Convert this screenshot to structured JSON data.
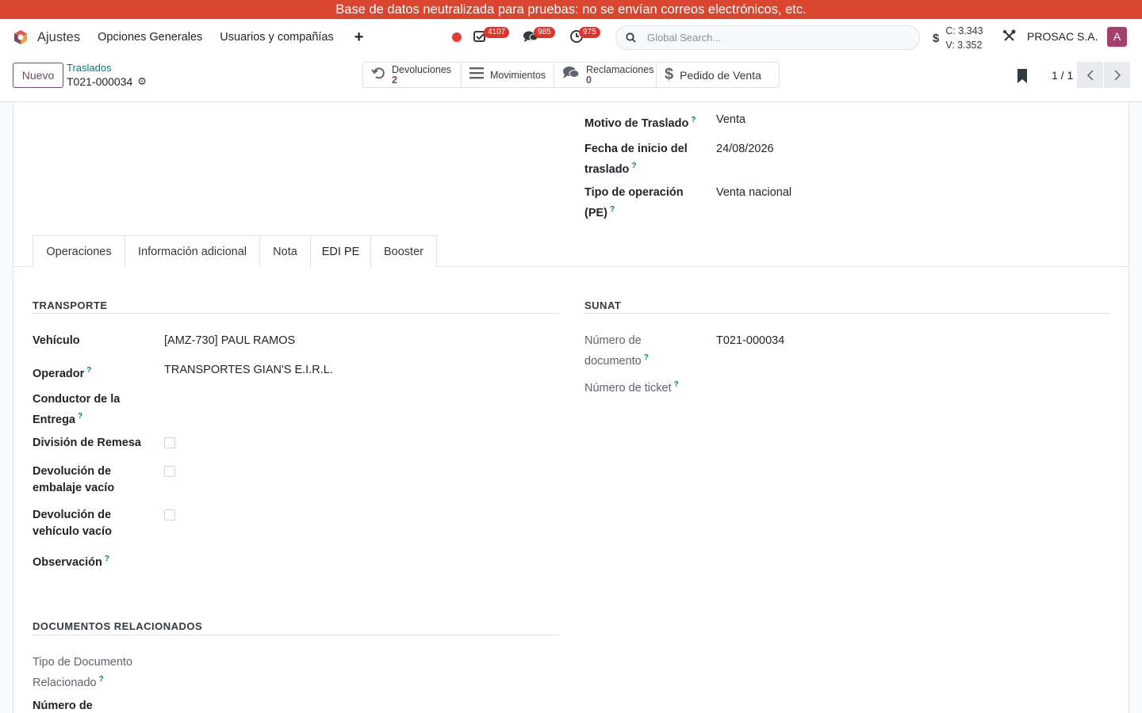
{
  "banner": {
    "text": "Base de datos neutralizada para pruebas: no se envían correos electrónicos, etc."
  },
  "navbar": {
    "app_name": "Ajustes",
    "menu": [
      "Opciones Generales",
      "Usuarios y compañías"
    ],
    "plus": "+",
    "badges": {
      "activities": "4107",
      "messages": "985",
      "clock": "975"
    },
    "search_placeholder": "Global Search...",
    "currency": {
      "symbol": "$",
      "buy": "C: 3.343",
      "sell": "V: 3.352"
    },
    "company": "PROSAC S.A.",
    "avatar_letter": "A"
  },
  "control": {
    "new_button": "Nuevo",
    "breadcrumb_parent": "Traslados",
    "record_name": "T021-000034",
    "smart_buttons": {
      "returns": {
        "label": "Devoluciones",
        "value": "2"
      },
      "moves": {
        "label": "Movimientos"
      },
      "claims": {
        "label": "Reclamaciones",
        "value": "0"
      },
      "sale_order": {
        "label": "Pedido de Venta"
      }
    },
    "pager": "1 / 1"
  },
  "header_fields": {
    "motivo": {
      "label": "Motivo de Traslado",
      "value": "Venta"
    },
    "fecha": {
      "label_1": "Fecha de inicio del",
      "label_2": "traslado",
      "value": "24/08/2026"
    },
    "tipo": {
      "label_1": "Tipo de operación",
      "label_2": "(PE)",
      "value": "Venta nacional"
    }
  },
  "tabs": [
    "Operaciones",
    "Información adicional",
    "Nota",
    "EDI PE",
    "Booster"
  ],
  "transporte": {
    "title": "TRANSPORTE",
    "vehiculo": {
      "label": "Vehículo",
      "value": "[AMZ-730] PAUL RAMOS"
    },
    "operador": {
      "label": "Operador",
      "value": "TRANSPORTES GIAN'S E.I.R.L."
    },
    "conductor": {
      "label_1": "Conductor de la",
      "label_2": "Entrega"
    },
    "division": {
      "label": "División de Remesa"
    },
    "dev_embalaje": {
      "label_1": "Devolución de",
      "label_2": "embalaje vacío"
    },
    "dev_vehiculo": {
      "label_1": "Devolución de",
      "label_2": "vehículo vacío"
    },
    "observacion": {
      "label": "Observación"
    }
  },
  "sunat": {
    "title": "SUNAT",
    "numero_documento": {
      "label_1": "Número de",
      "label_2": "documento",
      "value": "T021-000034"
    },
    "numero_ticket": {
      "label": "Número de ticket"
    }
  },
  "documentos": {
    "title": "DOCUMENTOS RELACIONADOS",
    "tipo_doc": {
      "label_1": "Tipo de Documento",
      "label_2": "Relacionado"
    },
    "numero": {
      "label": "Número de"
    }
  },
  "help_mark": "?"
}
